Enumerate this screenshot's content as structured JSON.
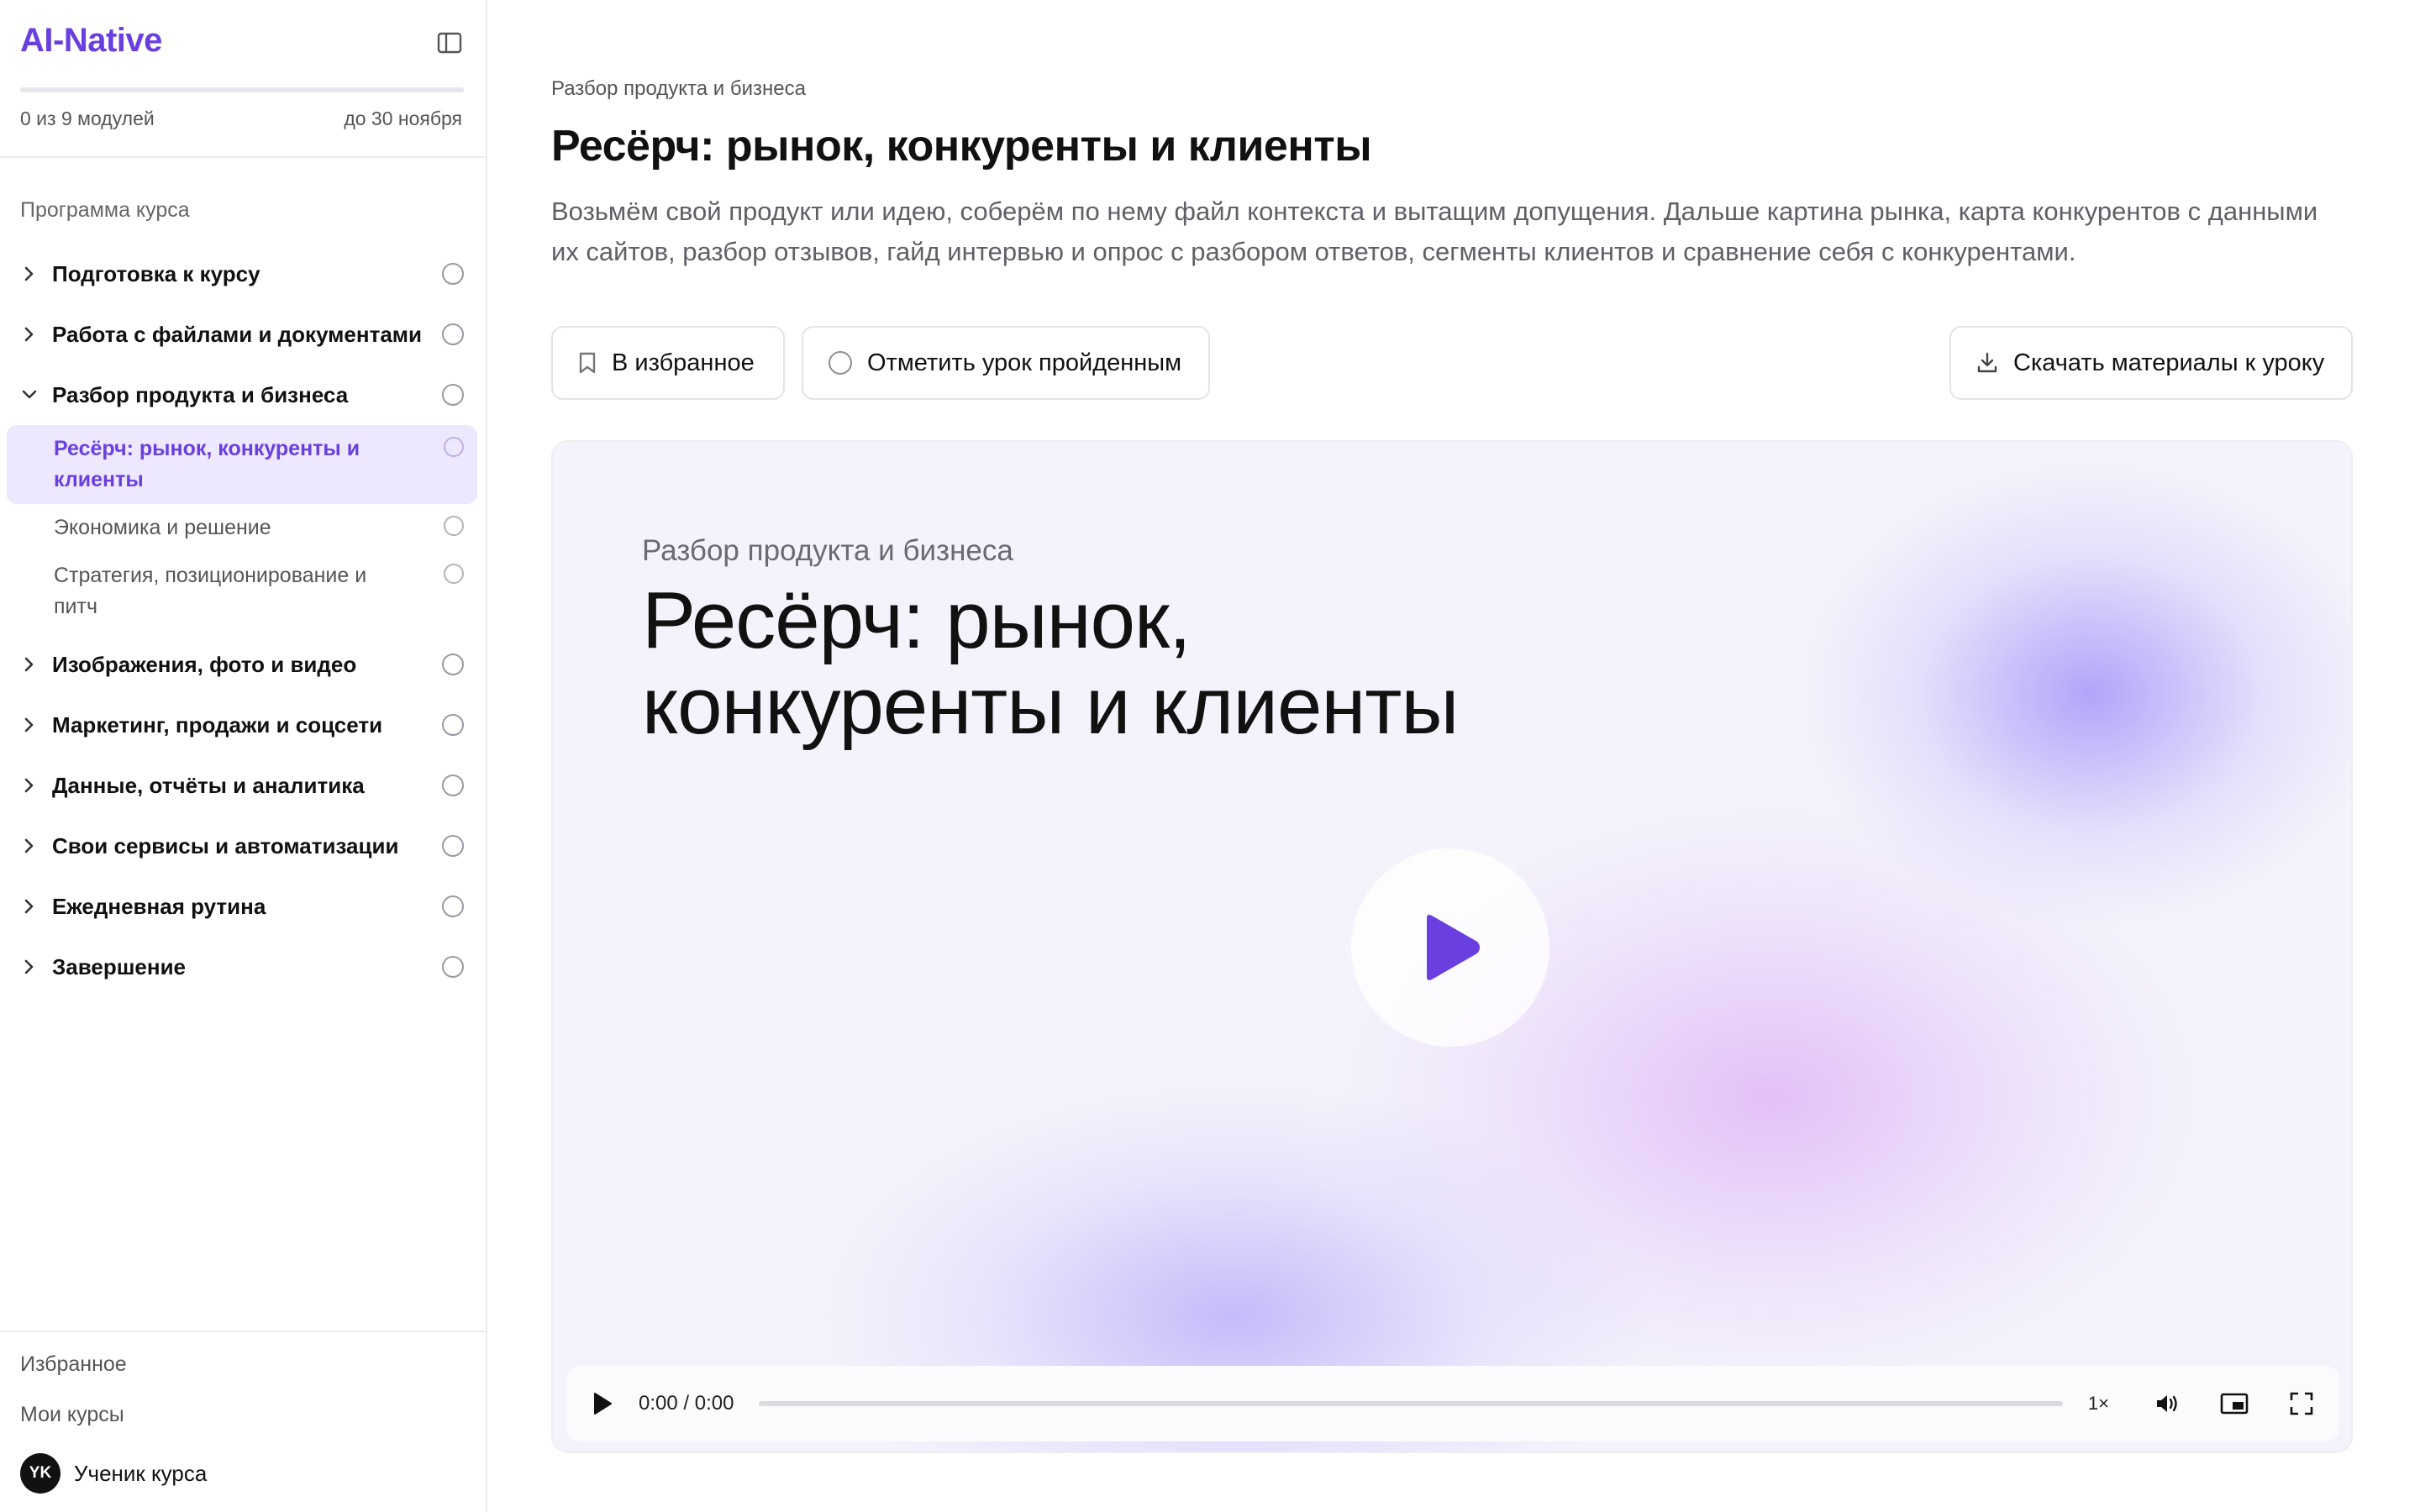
{
  "brand": {
    "name": "AI-Native"
  },
  "progress": {
    "count_text": "0 из 9 модулей",
    "deadline_text": "до 30 ноября",
    "fraction": 0
  },
  "sidebar": {
    "section_label": "Программа курса",
    "modules": [
      {
        "label": "Подготовка к курсу",
        "expanded": false
      },
      {
        "label": "Работа с файлами и документами",
        "expanded": false
      },
      {
        "label": "Разбор продукта и бизнеса",
        "expanded": true,
        "lessons": [
          {
            "label": "Ресёрч: рынок, конкуренты и клиенты",
            "active": true
          },
          {
            "label": "Экономика и решение",
            "active": false
          },
          {
            "label": "Стратегия, позиционирование и питч",
            "active": false
          }
        ]
      },
      {
        "label": "Изображения, фото и видео",
        "expanded": false
      },
      {
        "label": "Маркетинг, продажи и соцсети",
        "expanded": false
      },
      {
        "label": "Данные, отчёты и аналитика",
        "expanded": false
      },
      {
        "label": "Свои сервисы и автоматизации",
        "expanded": false
      },
      {
        "label": "Ежедневная рутина",
        "expanded": false
      },
      {
        "label": "Завершение",
        "expanded": false
      }
    ],
    "footer": {
      "favorites": "Избранное",
      "my_courses": "Мои курсы"
    },
    "user": {
      "initials": "YK",
      "name": "Ученик курса"
    }
  },
  "lesson": {
    "breadcrumb": "Разбор продукта и бизнеса",
    "title": "Ресёрч: рынок, конкуренты и клиенты",
    "description": "Возьмём свой продукт или идею, соберём по нему файл контекста и вытащим допущения. Дальше картина рынка, карта конкурентов с данными их сайтов, разбор отзывов, гайд интервью и опрос с разбором ответов, сегменты клиентов и сравнение себя с конкурентами.",
    "actions": {
      "favorite": "В избранное",
      "mark_done": "Отметить урок пройденным",
      "download": "Скачать материалы к уроку"
    }
  },
  "video": {
    "kicker": "Разбор продукта и бизнеса",
    "title_line1": "Ресёрч: рынок,",
    "title_line2": "конкуренты и клиенты",
    "time": "0:00 / 0:00",
    "speed": "1×",
    "progress": 0
  },
  "colors": {
    "accent": "#6a3fe0",
    "active_bg": "#ede8fd",
    "text": "#111111",
    "muted": "#5f5f66"
  }
}
